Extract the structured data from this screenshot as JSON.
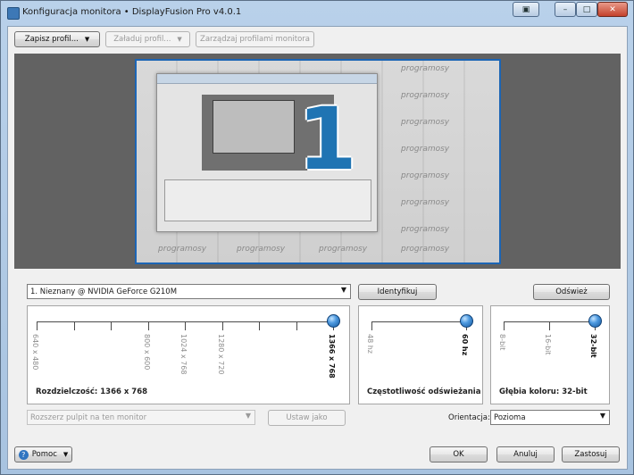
{
  "window": {
    "title": "Konfiguracja monitora • DisplayFusion Pro v4.0.1",
    "buttons": {
      "close": "✕",
      "maximize": "□",
      "minimize": "–",
      "extra": "▣"
    }
  },
  "toolbar": {
    "save_profile": "Zapisz profil...",
    "load_profile": "Załaduj profil...",
    "manage_profiles": "Zarządzaj profilami monitora"
  },
  "preview": {
    "monitor_number": "1",
    "watermark": "programosy"
  },
  "monitor_select": {
    "value": "1. Nieznany @ NVIDIA GeForce G210M",
    "identify": "Identyfikuj",
    "refresh": "Odśwież"
  },
  "resolution": {
    "options": [
      "640 x 480",
      "",
      "",
      "800 x 600",
      "1024 x 768",
      "1280 x 720",
      "",
      "",
      "1366 x 768"
    ],
    "selected_index": 8,
    "caption": "Rozdzielczość: 1366 x 768"
  },
  "refresh_rate": {
    "options": [
      "48 hz",
      "60 hz"
    ],
    "selected_index": 1,
    "caption": "Częstotliwość odświeżania"
  },
  "color_depth": {
    "options": [
      "8-bit",
      "16-bit",
      "32-bit"
    ],
    "selected_index": 2,
    "caption": "Głębia koloru: 32-bit"
  },
  "extend": {
    "value": "Rozszerz pulpit na ten monitor",
    "set_as": "Ustaw jako"
  },
  "orientation": {
    "label": "Orientacja:",
    "value": "Pozioma"
  },
  "footer": {
    "help": "Pomoc",
    "ok": "OK",
    "cancel": "Anuluj",
    "apply": "Zastosuj"
  },
  "colors": {
    "accent": "#1f74b3",
    "knob": "#4e9ae0",
    "preview_bg": "#626262"
  }
}
